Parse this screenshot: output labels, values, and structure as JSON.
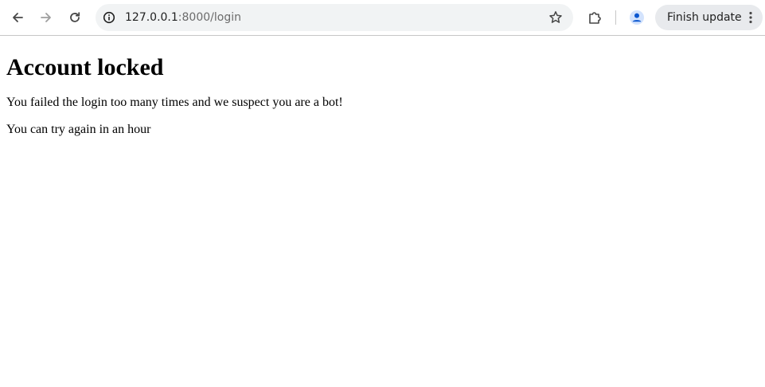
{
  "browser": {
    "url_host": "127.0.0.1",
    "url_rest": ":8000/login",
    "finish_update_label": "Finish update",
    "icons": {
      "back": "arrow-left-icon",
      "forward": "arrow-right-icon",
      "reload": "reload-icon",
      "site_info": "info-icon",
      "bookmark": "star-icon",
      "extensions": "puzzle-icon",
      "profile": "person-icon",
      "menu": "kebab-menu-icon"
    },
    "colors": {
      "profile_accent": "#0b57d0"
    }
  },
  "page": {
    "heading": "Account locked",
    "paragraph1": "You failed the login too many times and we suspect you are a bot!",
    "paragraph2": "You can try again in an hour"
  }
}
